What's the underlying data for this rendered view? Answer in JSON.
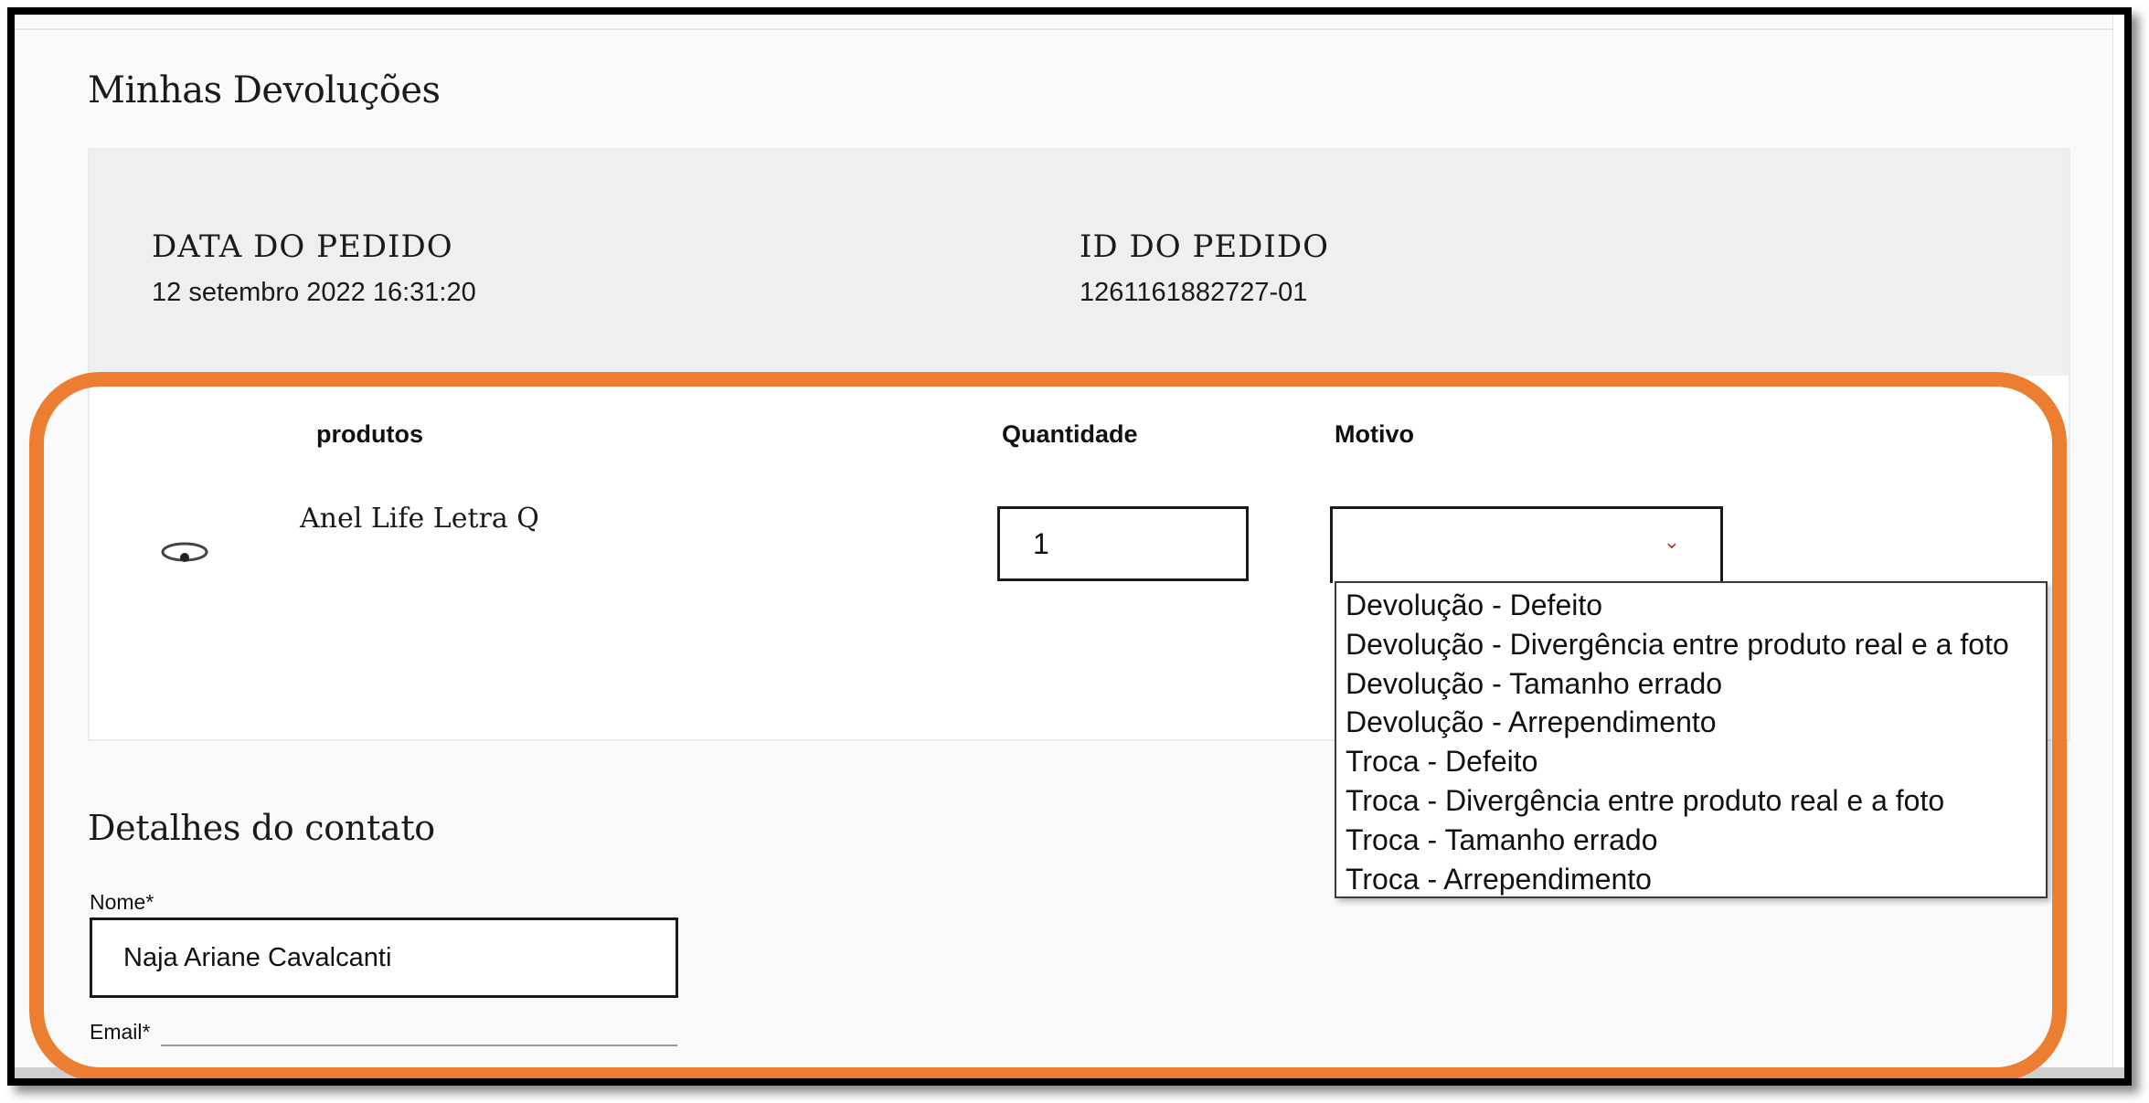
{
  "page": {
    "title": "Minhas Devoluções"
  },
  "order": {
    "date_label": "DATA DO PEDIDO",
    "date_value": "12 setembro 2022 16:31:20",
    "id_label": "ID DO PEDIDO",
    "id_value": "1261161882727-01"
  },
  "items_table": {
    "headers": {
      "product": "produtos",
      "quantity": "Quantidade",
      "reason": "Motivo"
    },
    "rows": [
      {
        "product_name": "Anel Life Letra Q",
        "quantity": "1",
        "reason": ""
      }
    ]
  },
  "reason_dropdown": {
    "expanded": true,
    "options": [
      "Devolução - Defeito",
      "Devolução - Divergência entre produto real e a foto",
      "Devolução - Tamanho errado",
      "Devolução - Arrependimento",
      "Troca - Defeito",
      "Troca - Divergência entre produto real e a foto",
      "Troca - Tamanho errado",
      "Troca - Arrependimento"
    ]
  },
  "contact": {
    "title": "Detalhes do contato",
    "name_label": "Nome*",
    "name_value": "Naja Ariane Cavalcanti",
    "email_label": "Email*",
    "email_value": ""
  },
  "colors": {
    "highlight": "#ed7d31",
    "header_bg": "#efefef",
    "chevron": "#c0392b"
  },
  "icons": {
    "product_thumbnail": "ring-icon",
    "dropdown_chevron": "chevron-down-icon"
  }
}
